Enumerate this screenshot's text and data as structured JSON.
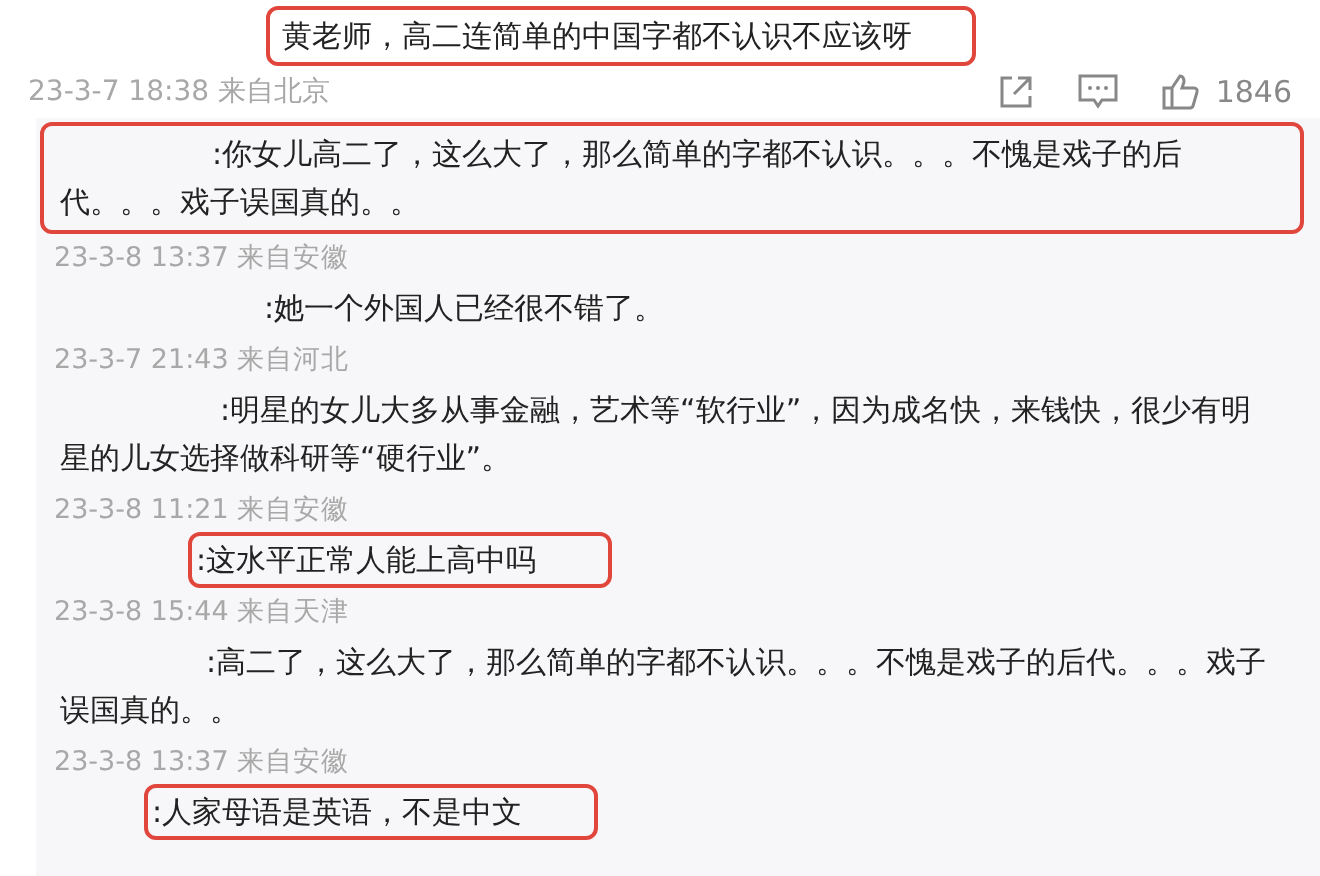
{
  "comment": {
    "text": "黄老师，高二连简单的中国字都不认识不应该呀",
    "highlighted": true,
    "time": "23-3-7 18:38",
    "location": "来自北京",
    "likes": "1846"
  },
  "replies": [
    {
      "text": ":你女儿高二了，这么大了，那么简单的字都不认识。。。不愧是戏子的后代。。。戏子误国真的。。",
      "highlighted": true,
      "time": "23-3-8 13:37",
      "location": "来自安徽"
    },
    {
      "text": ":她一个外国人已经很不错了。",
      "highlighted": false,
      "time": "23-3-7 21:43",
      "location": "来自河北"
    },
    {
      "text": ":明星的女儿大多从事金融，艺术等“软行业”，因为成名快，来钱快，很少有明星的儿女选择做科研等“硬行业”。",
      "highlighted": false,
      "time": "23-3-8 11:21",
      "location": "来自安徽"
    },
    {
      "text": ":这水平正常人能上高中吗",
      "highlighted": true,
      "time": "23-3-8 15:44",
      "location": "来自天津"
    },
    {
      "text": ":高二了，这么大了，那么简单的字都不认识。。。不愧是戏子的后代。。。戏子误国真的。。",
      "highlighted": false,
      "time": "23-3-8 13:37",
      "location": "来自安徽"
    },
    {
      "text": ":人家母语是英语，不是中文",
      "highlighted": true
    }
  ]
}
